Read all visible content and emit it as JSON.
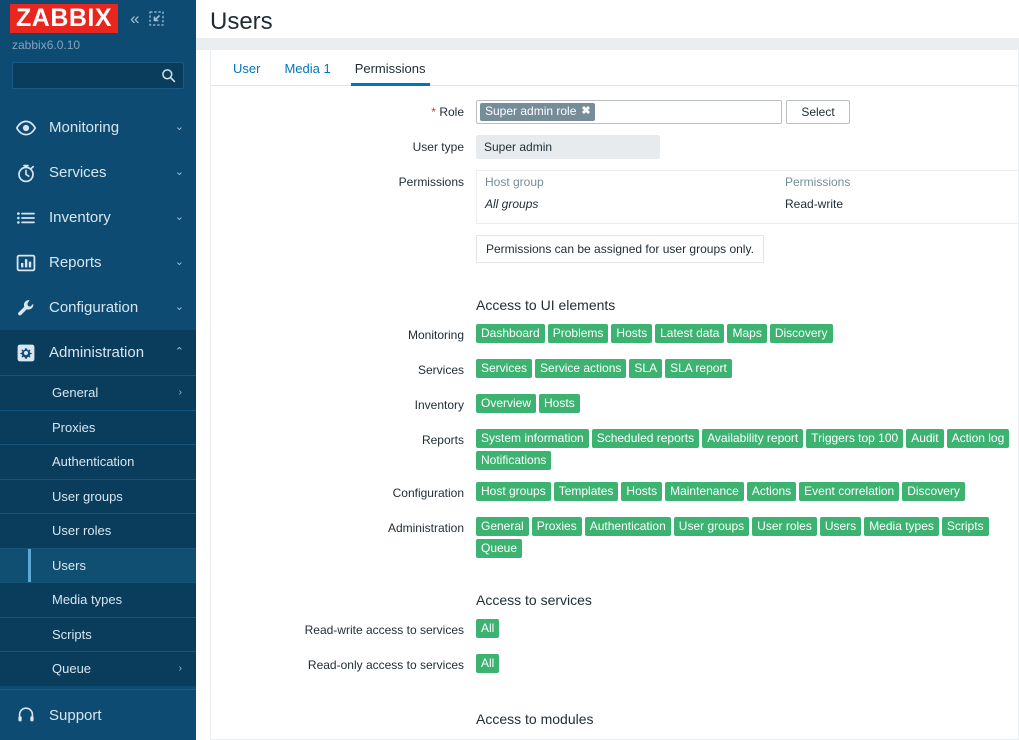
{
  "sidebar": {
    "logo_text": "ZABBIX",
    "version": "zabbix6.0.10",
    "collapse_icon": "chevron-double-left-icon",
    "compact_icon": "compact-view-icon",
    "search": {
      "value": "",
      "placeholder": ""
    },
    "nav": [
      {
        "label": "Monitoring",
        "icon": "eye-icon",
        "arrow": "⌄",
        "expanded": false
      },
      {
        "label": "Services",
        "icon": "clock-icon",
        "arrow": "⌄",
        "expanded": false
      },
      {
        "label": "Inventory",
        "icon": "list-icon",
        "arrow": "⌄",
        "expanded": false
      },
      {
        "label": "Reports",
        "icon": "bar-chart-icon",
        "arrow": "⌄",
        "expanded": false
      },
      {
        "label": "Configuration",
        "icon": "wrench-icon",
        "arrow": "⌄",
        "expanded": false
      },
      {
        "label": "Administration",
        "icon": "gear-icon",
        "arrow": "⌃",
        "expanded": true
      }
    ],
    "submenu": [
      {
        "label": "General",
        "arrow": "›",
        "selected": false
      },
      {
        "label": "Proxies",
        "arrow": "",
        "selected": false
      },
      {
        "label": "Authentication",
        "arrow": "",
        "selected": false
      },
      {
        "label": "User groups",
        "arrow": "",
        "selected": false
      },
      {
        "label": "User roles",
        "arrow": "",
        "selected": false
      },
      {
        "label": "Users",
        "arrow": "",
        "selected": true
      },
      {
        "label": "Media types",
        "arrow": "",
        "selected": false
      },
      {
        "label": "Scripts",
        "arrow": "",
        "selected": false
      },
      {
        "label": "Queue",
        "arrow": "›",
        "selected": false
      }
    ],
    "support": {
      "label": "Support",
      "icon": "headset-icon"
    }
  },
  "page": {
    "title": "Users"
  },
  "tabs": [
    {
      "label": "User",
      "active": false
    },
    {
      "label": "Media 1",
      "active": false
    },
    {
      "label": "Permissions",
      "active": true
    }
  ],
  "form": {
    "role": {
      "label": "Role",
      "required_marker": "*",
      "chip": "Super admin role",
      "chip_close": "✖",
      "select_button": "Select"
    },
    "user_type": {
      "label": "User type",
      "value": "Super admin"
    },
    "permissions": {
      "label": "Permissions",
      "columns": [
        "Host group",
        "Permissions"
      ],
      "rows": [
        {
          "host_group": "All groups",
          "permission": "Read-write"
        }
      ],
      "notice": "Permissions can be assigned for user groups only."
    }
  },
  "ui_elements": {
    "section_title": "Access to UI elements",
    "rows": [
      {
        "label": "Monitoring",
        "badges": [
          "Dashboard",
          "Problems",
          "Hosts",
          "Latest data",
          "Maps",
          "Discovery"
        ]
      },
      {
        "label": "Services",
        "badges": [
          "Services",
          "Service actions",
          "SLA",
          "SLA report"
        ]
      },
      {
        "label": "Inventory",
        "badges": [
          "Overview",
          "Hosts"
        ]
      },
      {
        "label": "Reports",
        "badges": [
          "System information",
          "Scheduled reports",
          "Availability report",
          "Triggers top 100",
          "Audit",
          "Action log",
          "Notifications"
        ]
      },
      {
        "label": "Configuration",
        "badges": [
          "Host groups",
          "Templates",
          "Hosts",
          "Maintenance",
          "Actions",
          "Event correlation",
          "Discovery"
        ]
      },
      {
        "label": "Administration",
        "badges": [
          "General",
          "Proxies",
          "Authentication",
          "User groups",
          "User roles",
          "Users",
          "Media types",
          "Scripts",
          "Queue"
        ]
      }
    ]
  },
  "services_access": {
    "section_title": "Access to services",
    "rows": [
      {
        "label": "Read-write access to services",
        "badges": [
          "All"
        ]
      },
      {
        "label": "Read-only access to services",
        "badges": [
          "All"
        ]
      }
    ]
  },
  "modules_access": {
    "section_title": "Access to modules"
  },
  "colors": {
    "sidebar_bg": "#0e4b72",
    "sidebar_submenu_bg": "#0a3c5c",
    "logo_red": "#e8261e",
    "accent_blue": "#0275b8",
    "badge_green": "#3cb371",
    "chip_gray": "#768d99",
    "required_red": "#d33931"
  }
}
